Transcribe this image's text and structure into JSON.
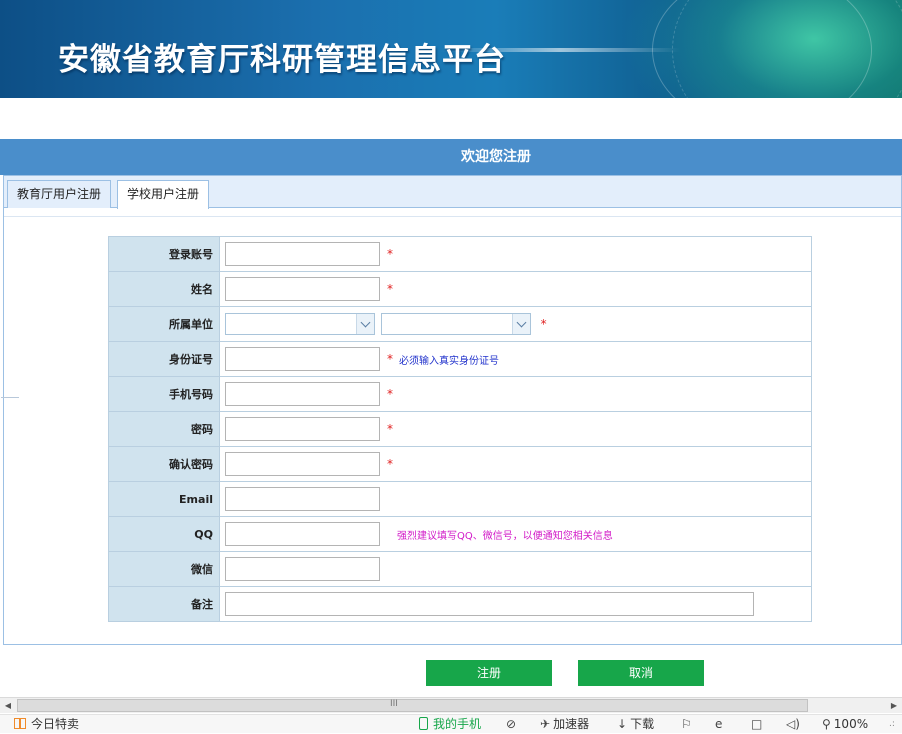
{
  "banner": {
    "title": "安徽省教育厅科研管理信息平台"
  },
  "welcome": {
    "text": "欢迎您注册"
  },
  "tabs": [
    {
      "label": "教育厅用户注册",
      "active": false
    },
    {
      "label": "学校用户注册",
      "active": true
    }
  ],
  "form": {
    "account_label": "登录账号",
    "name_label": "姓名",
    "unit_label": "所属单位",
    "id_label": "身份证号",
    "id_hint": "必须输入真实身份证号",
    "phone_label": "手机号码",
    "password_label": "密码",
    "confirm_label": "确认密码",
    "email_label": "Email",
    "qq_label": "QQ",
    "qq_hint": "强烈建议填写QQ、微信号，以便通知您相关信息",
    "wechat_label": "微信",
    "remark_label": "备注",
    "required_mark": "*",
    "unit_select_1": "",
    "unit_select_2": ""
  },
  "buttons": {
    "register": "注册",
    "cancel": "取消"
  },
  "scrollbar": {
    "left_arrow": "◀",
    "right_arrow": "▶",
    "grip": "III"
  },
  "statusbar": {
    "today_deal": "今日特卖",
    "my_phone": "我的手机",
    "accelerator": "加速器",
    "download": "下载",
    "zoom": "100%"
  },
  "colors": {
    "header": "#4a8ecb",
    "label_bg": "#d0e3ee",
    "button": "#17a64a",
    "required": "#e02020",
    "hint_blue": "#2233cc",
    "hint_pink": "#d21bc8"
  }
}
